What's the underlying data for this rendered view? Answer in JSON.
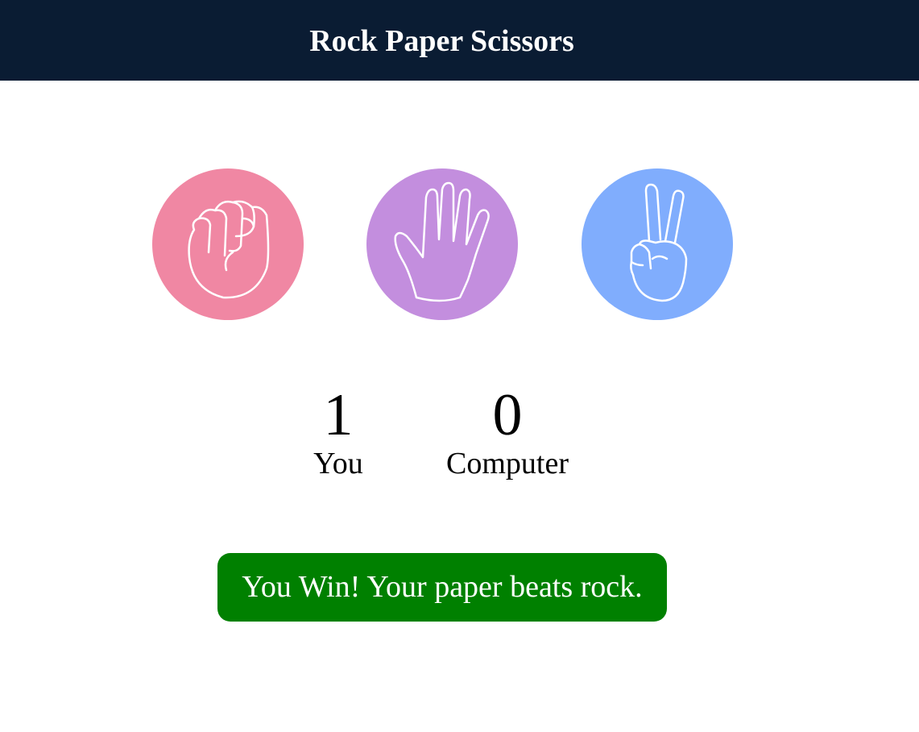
{
  "header": {
    "title": "Rock Paper Scissors",
    "background": "#0a1c33"
  },
  "choices": [
    {
      "id": "rock",
      "icon": "fist-icon",
      "color": "#f087a3"
    },
    {
      "id": "paper",
      "icon": "open-hand-icon",
      "color": "#c38ede"
    },
    {
      "id": "scissors",
      "icon": "peace-sign-icon",
      "color": "#80adfd"
    }
  ],
  "scoreboard": {
    "you": {
      "score": "1",
      "label": "You"
    },
    "computer": {
      "score": "0",
      "label": "Computer"
    }
  },
  "result": {
    "message": "You Win! Your paper beats rock.",
    "color": "#008000"
  }
}
